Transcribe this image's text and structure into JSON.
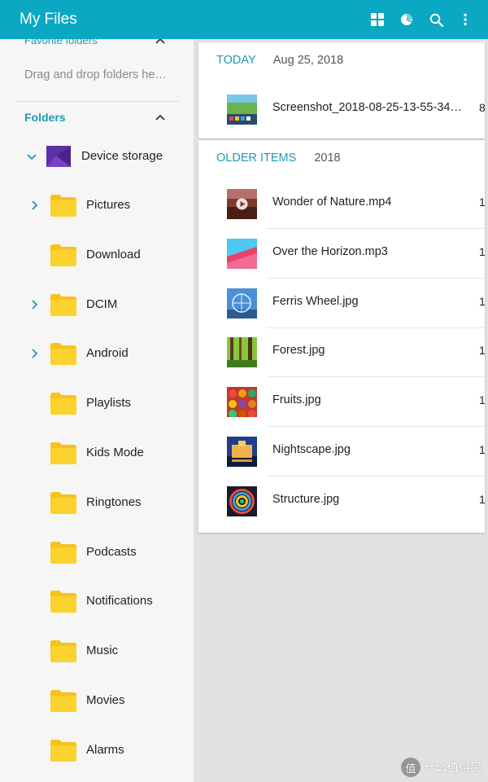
{
  "app": {
    "title": "My Files"
  },
  "toolbar": {
    "icons": [
      "grid-view-icon",
      "storage-analysis-icon",
      "search-icon",
      "more-options-icon"
    ],
    "accent": "#0ba8c3"
  },
  "sidebar": {
    "favorite_label": "Favorite folders",
    "drag_hint": "Drag and drop folders he…",
    "folders_label": "Folders",
    "device_storage": "Device storage",
    "items": [
      {
        "label": "Pictures",
        "expandable": true
      },
      {
        "label": "Download",
        "expandable": false
      },
      {
        "label": "DCIM",
        "expandable": true
      },
      {
        "label": "Android",
        "expandable": true
      },
      {
        "label": "Playlists",
        "expandable": false
      },
      {
        "label": "Kids Mode",
        "expandable": false
      },
      {
        "label": "Ringtones",
        "expandable": false
      },
      {
        "label": "Podcasts",
        "expandable": false
      },
      {
        "label": "Notifications",
        "expandable": false
      },
      {
        "label": "Music",
        "expandable": false
      },
      {
        "label": "Movies",
        "expandable": false
      },
      {
        "label": "Alarms",
        "expandable": false
      }
    ]
  },
  "today": {
    "key": "TODAY",
    "date": "Aug 25, 2018",
    "files": [
      {
        "name": "Screenshot_2018-08-25-13-55-34…",
        "meta": "8"
      }
    ]
  },
  "older": {
    "key": "OLDER ITEMS",
    "date": "2018",
    "files": [
      {
        "name": "Wonder of Nature.mp4",
        "meta": "1"
      },
      {
        "name": "Over the Horizon.mp3",
        "meta": "1"
      },
      {
        "name": "Ferris Wheel.jpg",
        "meta": "1"
      },
      {
        "name": "Forest.jpg",
        "meta": "1"
      },
      {
        "name": "Fruits.jpg",
        "meta": "1"
      },
      {
        "name": "Nightscape.jpg",
        "meta": "1"
      },
      {
        "name": "Structure.jpg",
        "meta": "1"
      }
    ]
  },
  "watermark": {
    "mark": "值",
    "text": "什么值得买"
  }
}
